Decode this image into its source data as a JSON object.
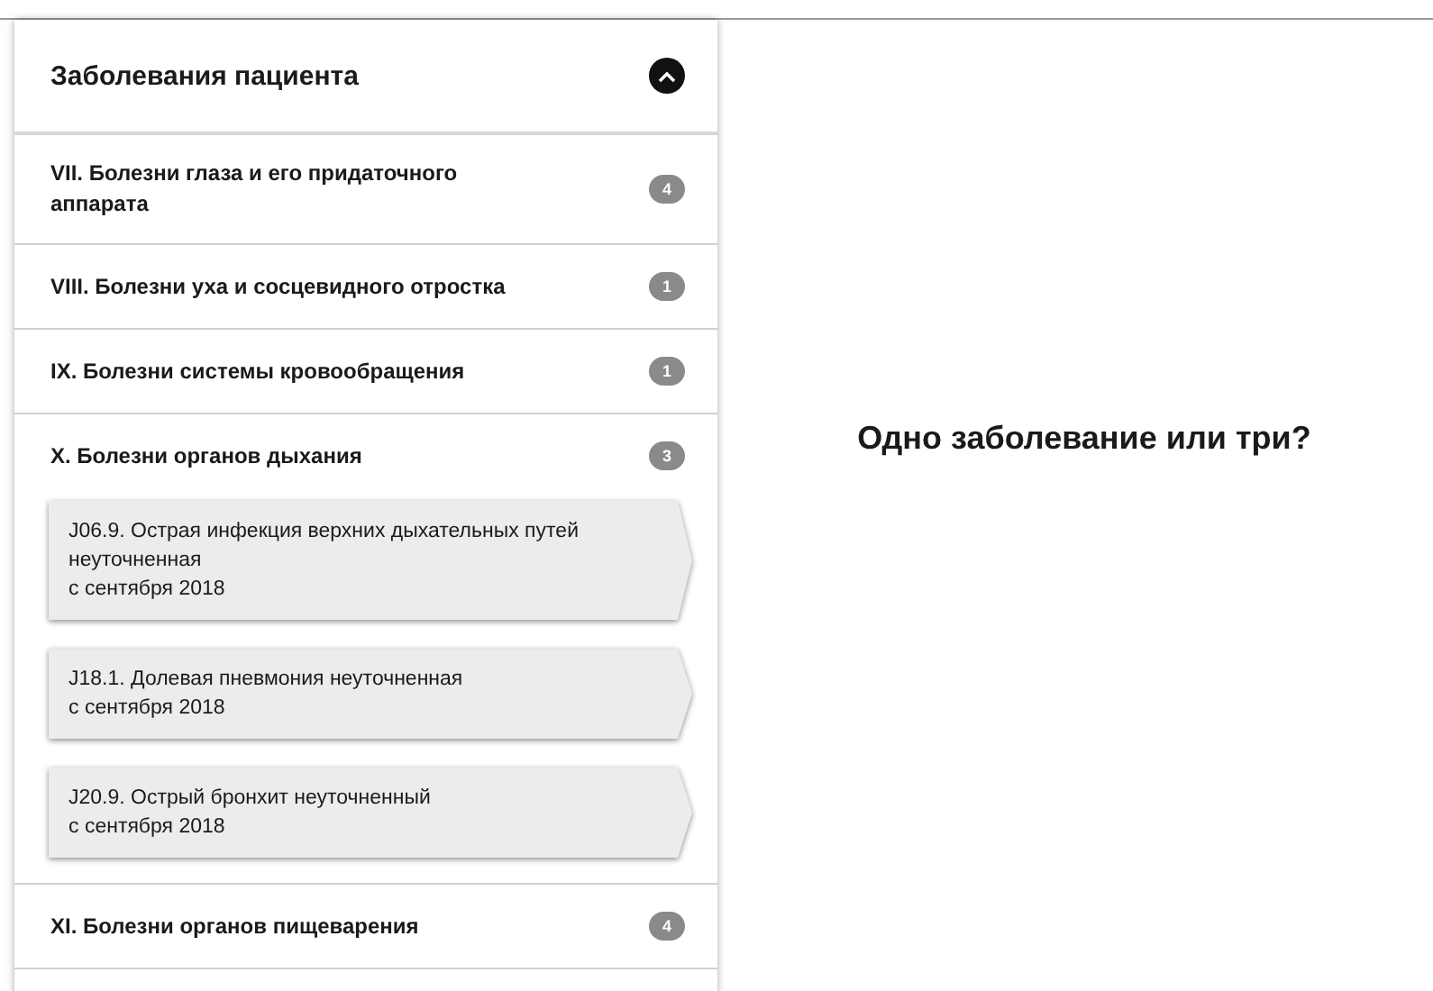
{
  "panel": {
    "title": "Заболевания пациента",
    "expanded": true
  },
  "groups": [
    {
      "label": "VII. Болезни глаза и его придаточного аппарата",
      "count": "4",
      "expanded": false
    },
    {
      "label": "VIII. Болезни уха и сосцевидного отростка",
      "count": "1",
      "expanded": false
    },
    {
      "label": "IX. Болезни системы кровообращения",
      "count": "1",
      "expanded": false
    },
    {
      "label": "X. Болезни органов дыхания",
      "count": "3",
      "expanded": true,
      "children": [
        {
          "diagnosis": "J06.9. Острая инфекция верхних дыхательных путей неуточненная",
          "since": "с сентября 2018"
        },
        {
          "diagnosis": "J18.1. Долевая пневмония неуточненная",
          "since": "с сентября 2018"
        },
        {
          "diagnosis": "J20.9. Острый бронхит неуточненный",
          "since": "с сентября 2018"
        }
      ]
    },
    {
      "label": "XI. Болезни органов пищеварения",
      "count": "4",
      "expanded": false
    }
  ],
  "caption": "Одно заболевание или три?"
}
